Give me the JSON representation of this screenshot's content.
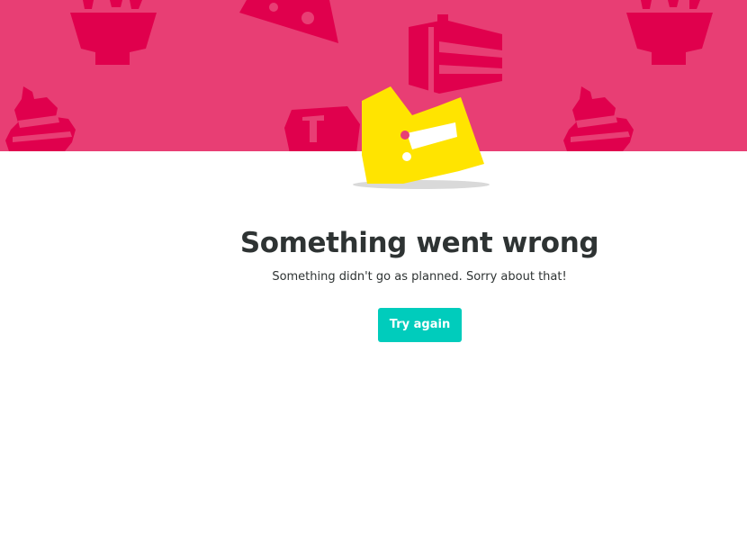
{
  "error": {
    "title": "Something went wrong",
    "message": "Something didn't go as planned. Sorry about that!",
    "retry_label": "Try again"
  },
  "colors": {
    "banner": "#e83e74",
    "food_illustration": "#e0004d",
    "mascot": "#ffe400",
    "button": "#00ccbc",
    "text": "#2e3333"
  },
  "icons": {
    "banner_illustrations": [
      "bowl-icon",
      "pie-slice-icon",
      "cake-slice-icon",
      "ice-cream-icon",
      "cup-icon",
      "bowl-icon",
      "ice-cream-icon"
    ],
    "mascot": "deliveroo-kangaroo-logo"
  }
}
